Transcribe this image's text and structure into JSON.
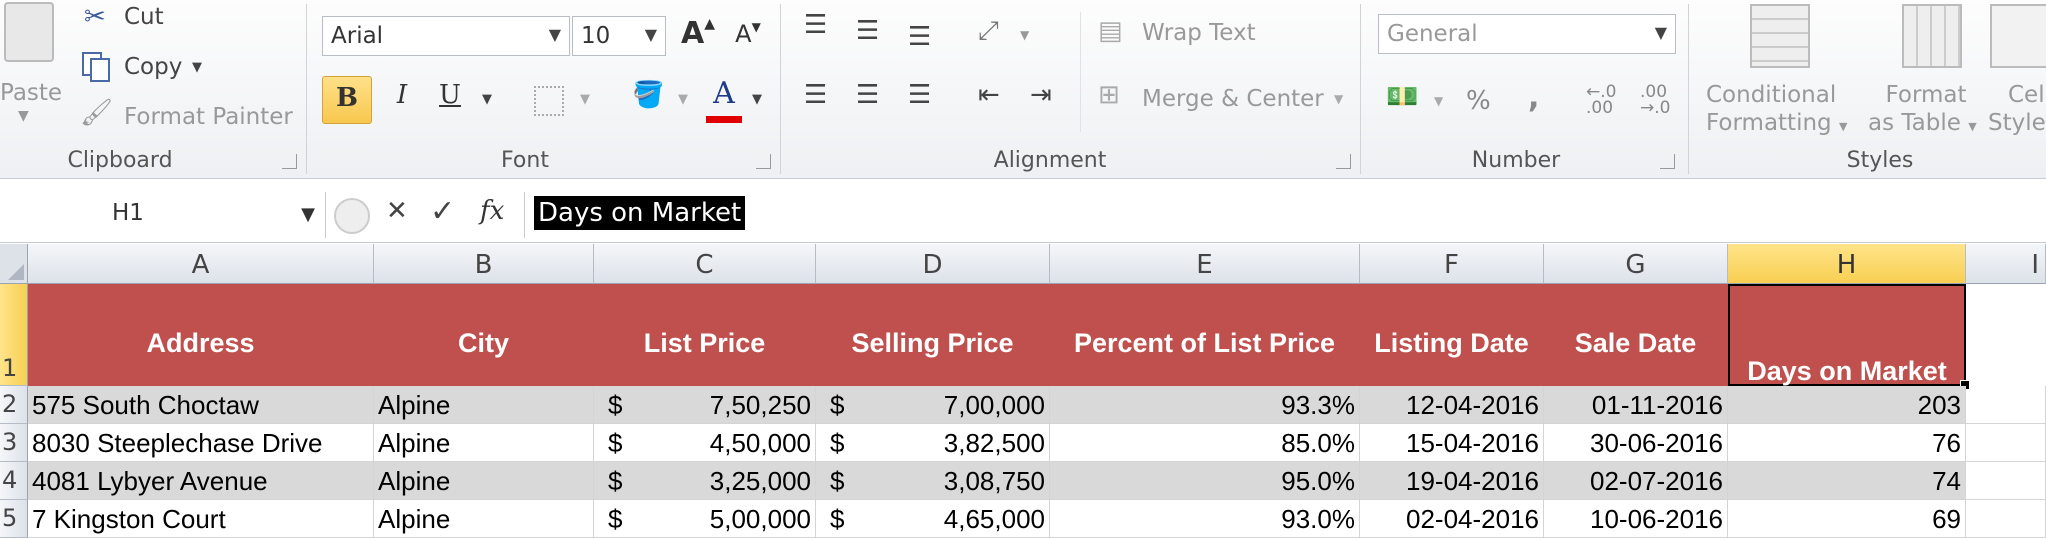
{
  "clipboard": {
    "paste": "Paste",
    "cut": "Cut",
    "copy": "Copy",
    "format_painter": "Format Painter",
    "label": "Clipboard"
  },
  "font": {
    "name": "Arial",
    "size": "10",
    "bold": "B",
    "italic": "I",
    "underline": "U",
    "font_color_glyph": "A",
    "grow_glyph": "A",
    "shrink_glyph": "A",
    "label": "Font",
    "font_color": "#e00000"
  },
  "alignment": {
    "wrap_text": "Wrap Text",
    "merge_center": "Merge & Center",
    "label": "Alignment"
  },
  "number": {
    "format": "General",
    "percent": "%",
    "comma": ",",
    "label": "Number"
  },
  "styles": {
    "conditional_formatting_1": "Conditional",
    "conditional_formatting_2": "Formatting",
    "format_as_table_1": "Format",
    "format_as_table_2": "as Table",
    "cell_styles_1": "Cell",
    "cell_styles_2": "Styles",
    "label": "Styles"
  },
  "formula_bar": {
    "name_box": "H1",
    "cancel": "✕",
    "enter": "✓",
    "fx": "fx",
    "content": "Days on Market"
  },
  "sheet": {
    "columns": [
      "A",
      "B",
      "C",
      "D",
      "E",
      "F",
      "G",
      "H",
      "I"
    ],
    "rows": [
      "1",
      "2",
      "3",
      "4",
      "5"
    ],
    "header_color": "#c0504d",
    "headers": [
      "Address",
      "City",
      "List Price",
      "Selling Price",
      "Percent of List Price",
      "Listing Date",
      "Sale Date",
      "Days on Market"
    ],
    "data": [
      {
        "address": "575 South Choctaw",
        "city": "Alpine",
        "list_cur": "$",
        "list_price": "7,50,250",
        "sell_cur": "$",
        "selling_price": "7,00,000",
        "percent": "93.3%",
        "listing_date": "12-04-2016",
        "sale_date": "01-11-2016",
        "days": "203"
      },
      {
        "address": "8030 Steeplechase Drive",
        "city": "Alpine",
        "list_cur": "$",
        "list_price": "4,50,000",
        "sell_cur": "$",
        "selling_price": "3,82,500",
        "percent": "85.0%",
        "listing_date": "15-04-2016",
        "sale_date": "30-06-2016",
        "days": "76"
      },
      {
        "address": "4081 Lybyer Avenue",
        "city": "Alpine",
        "list_cur": "$",
        "list_price": "3,25,000",
        "sell_cur": "$",
        "selling_price": "3,08,750",
        "percent": "95.0%",
        "listing_date": "19-04-2016",
        "sale_date": "02-07-2016",
        "days": "74"
      },
      {
        "address": "7 Kingston Court",
        "city": "Alpine",
        "list_cur": "$",
        "list_price": "5,00,000",
        "sell_cur": "$",
        "selling_price": "4,65,000",
        "percent": "93.0%",
        "listing_date": "02-04-2016",
        "sale_date": "10-06-2016",
        "days": "69"
      }
    ]
  }
}
